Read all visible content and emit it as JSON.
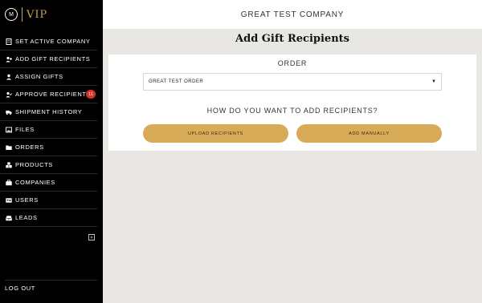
{
  "brand": {
    "logo_mark": "M",
    "name": "VIP"
  },
  "sidebar": {
    "items": [
      {
        "label": "Set Active Company",
        "icon": "building-icon"
      },
      {
        "label": "Add Gift Recipients",
        "icon": "user-plus-icon"
      },
      {
        "label": "Assign Gifts",
        "icon": "user-icon"
      },
      {
        "label": "Approve Recipients",
        "icon": "user-check-icon",
        "badge": "11"
      },
      {
        "label": "Shipment History",
        "icon": "truck-icon"
      },
      {
        "label": "Files",
        "icon": "image-icon"
      },
      {
        "label": "Orders",
        "icon": "folder-icon"
      },
      {
        "label": "Products",
        "icon": "boxes-icon"
      },
      {
        "label": "Companies",
        "icon": "briefcase-icon"
      },
      {
        "label": "Users",
        "icon": "id-card-icon"
      },
      {
        "label": "Leads",
        "icon": "inbox-icon"
      }
    ],
    "collapse_icon": "collapse-icon",
    "logout": "Log Out"
  },
  "header": {
    "company": "Great Test Company"
  },
  "main": {
    "title": "Add Gift Recipients",
    "order_label": "Order",
    "order_select": {
      "value": "Great Test Order"
    },
    "question": "How do you want to add recipients?",
    "upload_label": "Upload Recipients",
    "manual_label": "Add Manually"
  },
  "colors": {
    "accent": "#d7ab58",
    "badge": "#d9322b",
    "sidebar": "#000000"
  }
}
